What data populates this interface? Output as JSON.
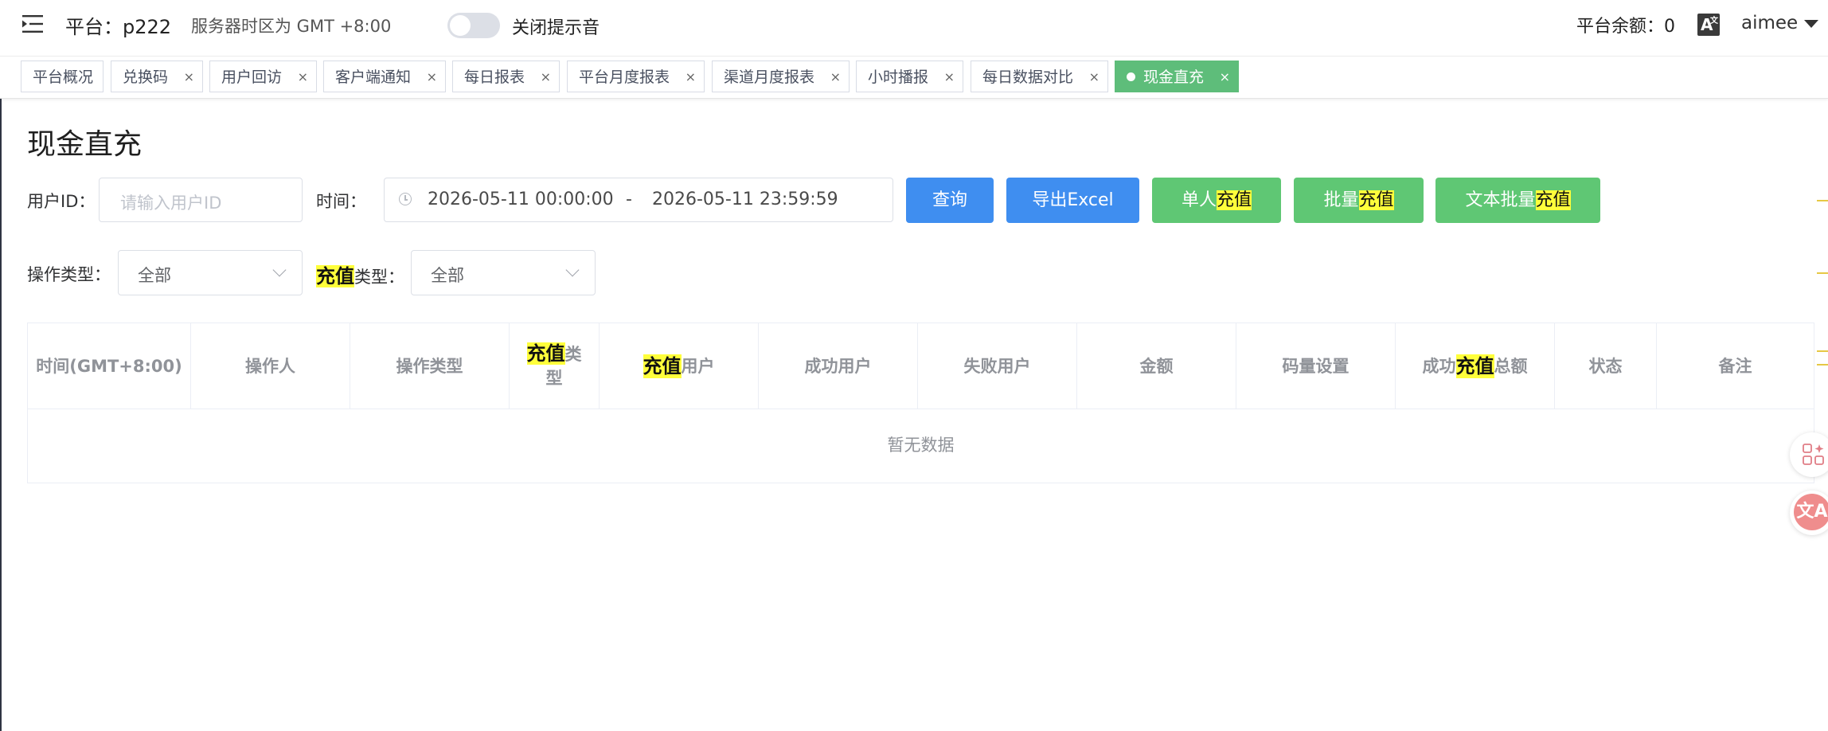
{
  "header": {
    "platform": "平台：p222",
    "timezone": "服务器时区为 GMT +8:00",
    "sound_switch_label": "关闭提示音",
    "balance": "平台余额：0",
    "lang_icon": "A",
    "user": "aimee"
  },
  "tags": [
    {
      "label": "平台概况"
    },
    {
      "label": "兑换码"
    },
    {
      "label": "用户回访"
    },
    {
      "label": "客户端通知"
    },
    {
      "label": "每日报表"
    },
    {
      "label": "平台月度报表"
    },
    {
      "label": "渠道月度报表"
    },
    {
      "label": "小时播报"
    },
    {
      "label": "每日数据对比"
    },
    {
      "label": "现金直充",
      "active": true
    }
  ],
  "tag_close": "×",
  "page": {
    "title": "现金直充"
  },
  "filters": {
    "user_id_label": "用户ID：",
    "user_id_placeholder": "请输入用户ID",
    "time_label": "时间：",
    "date_start": "2026-05-11 00:00:00",
    "date_sep": "-",
    "date_end": "2026-05-11 23:59:59",
    "op_type_label": "操作类型：",
    "op_type_value": "全部",
    "recharge_type_label_hl": "充值",
    "recharge_type_label_rest": "类型：",
    "recharge_type_value": "全部"
  },
  "buttons": {
    "query": "查询",
    "export": "导出Excel",
    "single_pre": "单人",
    "single_hl": "充值",
    "batch_pre": "批量",
    "batch_hl": "充值",
    "text_batch_pre": "文本批量",
    "text_batch_hl": "充值"
  },
  "table": {
    "columns": {
      "time": "时间(GMT+8:00)",
      "operator": "操作人",
      "op_type": "操作类型",
      "recharge_type_hl": "充值",
      "recharge_type_rest1": "类",
      "recharge_type_rest2": "型",
      "recharge_user_hl": "充值",
      "recharge_user_rest": "用户",
      "success_user": "成功用户",
      "fail_user": "失败用户",
      "amount": "金额",
      "code_setting": "码量设置",
      "success_pre": "成功",
      "success_hl": "充值",
      "success_post": "总额",
      "status": "状态",
      "remark": "备注"
    },
    "empty_text": "暂无数据"
  },
  "colors": {
    "accent_blue": "#3f8ef0",
    "accent_green": "#5fc774",
    "active_tag": "#5ebd7a",
    "highlight": "#ffff3b"
  },
  "icons": [
    "menu-fold-icon",
    "clock-icon",
    "chevron-down-icon",
    "translate-icon",
    "apps-icon",
    "caret-down-icon"
  ]
}
